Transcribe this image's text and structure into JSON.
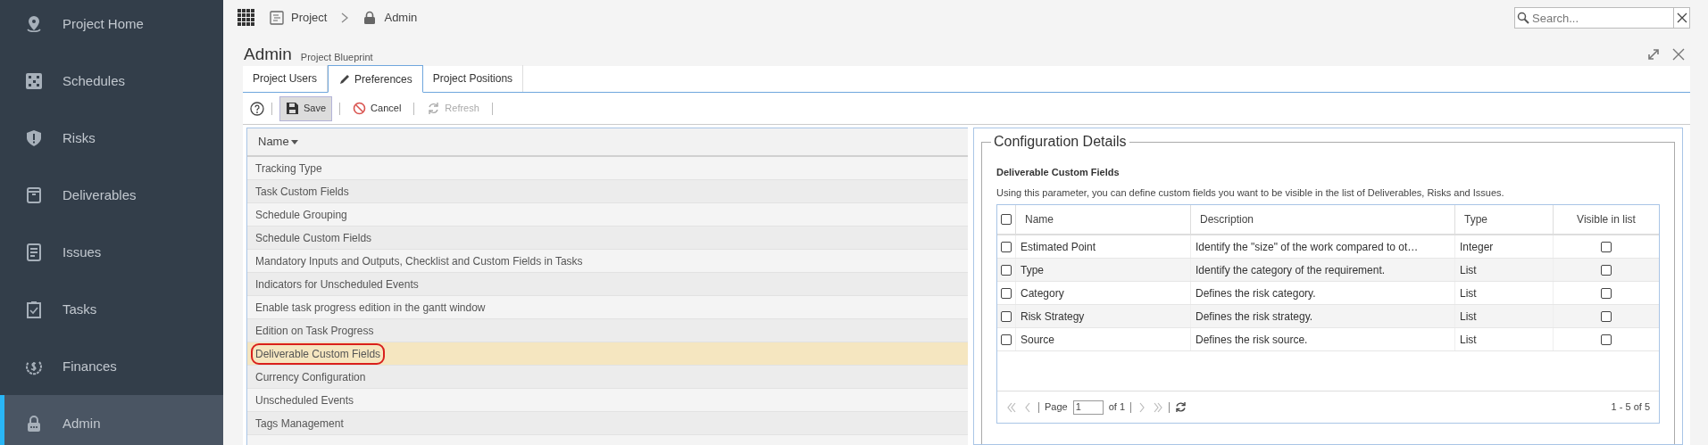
{
  "sidebar": {
    "items": [
      {
        "label": "Project Home",
        "selected": false
      },
      {
        "label": "Schedules",
        "selected": false
      },
      {
        "label": "Risks",
        "selected": false
      },
      {
        "label": "Deliverables",
        "selected": false
      },
      {
        "label": "Issues",
        "selected": false
      },
      {
        "label": "Tasks",
        "selected": false
      },
      {
        "label": "Finances",
        "selected": false
      },
      {
        "label": "Admin",
        "selected": true
      }
    ]
  },
  "breadcrumb": [
    {
      "label": "Project"
    },
    {
      "label": "Admin"
    }
  ],
  "search": {
    "placeholder": "Search..."
  },
  "page": {
    "title": "Admin",
    "subtitle": "Project Blueprint"
  },
  "tabs": [
    {
      "label": "Project Users",
      "selected": false
    },
    {
      "label": "Preferences",
      "selected": true
    },
    {
      "label": "Project Positions",
      "selected": false
    }
  ],
  "toolbar": [
    {
      "kind": "help"
    },
    {
      "kind": "save",
      "label": "Save",
      "disabled": false
    },
    {
      "kind": "cancel",
      "label": "Cancel",
      "disabled": false
    },
    {
      "kind": "refresh",
      "label": "Refresh",
      "disabled": true
    }
  ],
  "preferences": {
    "column": "Name",
    "items": [
      {
        "label": "Tracking Type",
        "selected": false
      },
      {
        "label": "Task Custom Fields",
        "selected": false
      },
      {
        "label": "Schedule Grouping",
        "selected": false
      },
      {
        "label": "Schedule Custom Fields",
        "selected": false
      },
      {
        "label": "Mandatory Inputs and Outputs, Checklist and Custom Fields in Tasks",
        "selected": false
      },
      {
        "label": "Indicators for Unscheduled Events",
        "selected": false
      },
      {
        "label": "Enable task progress edition in the gantt window",
        "selected": false
      },
      {
        "label": "Edition on Task Progress",
        "selected": false
      },
      {
        "label": "Deliverable Custom Fields",
        "selected": true
      },
      {
        "label": "Currency Configuration",
        "selected": false
      },
      {
        "label": "Unscheduled Events",
        "selected": false
      },
      {
        "label": "Tags Management",
        "selected": false
      }
    ]
  },
  "details": {
    "legend": "Configuration Details",
    "heading": "Deliverable Custom Fields",
    "description": "Using this parameter, you can define custom fields you want to be visible in the list of Deliverables, Risks and Issues.",
    "table": {
      "all_checked": false,
      "columns": [
        "Name",
        "Description",
        "Type",
        "Visible in list"
      ],
      "rows": [
        {
          "checked": false,
          "name": "Estimated Point",
          "description": "Identify the \"size\" of the work compared to ot…",
          "type": "Integer",
          "visible": false
        },
        {
          "checked": false,
          "name": "Type",
          "description": "Identify the category of the requirement.",
          "type": "List",
          "visible": false
        },
        {
          "checked": false,
          "name": "Category",
          "description": "Defines the risk category.",
          "type": "List",
          "visible": false
        },
        {
          "checked": false,
          "name": "Risk Strategy",
          "description": "Defines the risk strategy.",
          "type": "List",
          "visible": false
        },
        {
          "checked": false,
          "name": "Source",
          "description": "Defines the risk source.",
          "type": "List",
          "visible": false
        }
      ]
    },
    "pager": {
      "page_label": "Page",
      "page": "1",
      "of": "of 1",
      "summary": "1 - 5 of 5"
    }
  }
}
